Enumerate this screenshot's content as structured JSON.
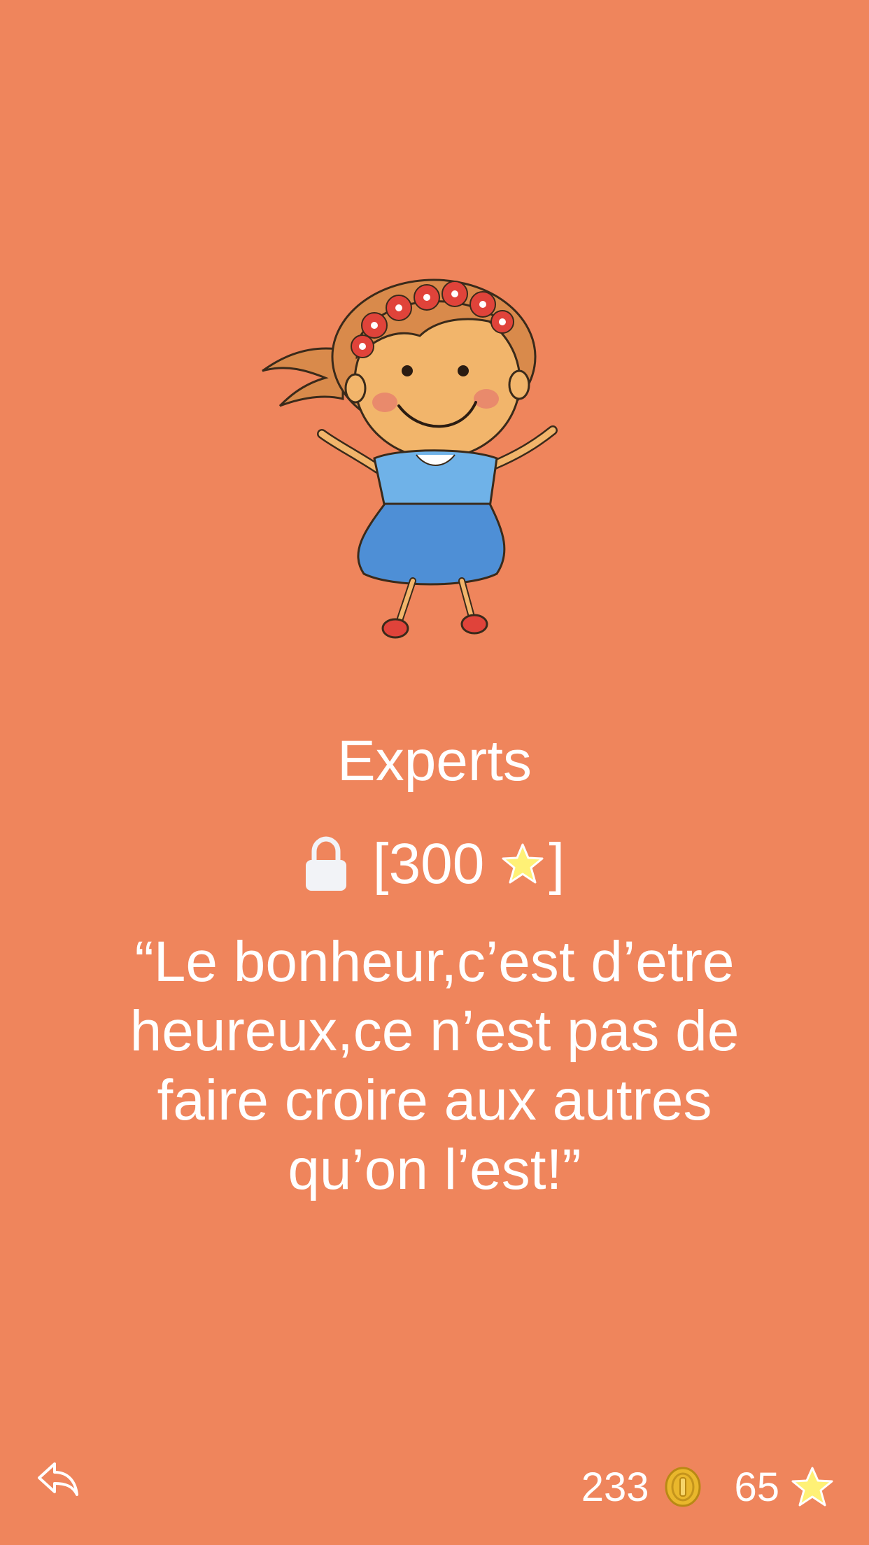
{
  "level": {
    "title": "Experts",
    "lock_cost_open": "[300",
    "lock_cost_close": "]",
    "quote": "“Le bonheur,c’est d’etre heureux,ce n’est pas de faire croire aux autres qu’on l’est!”"
  },
  "footer": {
    "coins": "233",
    "stars": "65"
  },
  "icons": {
    "lock": "lock-icon",
    "star": "star-icon",
    "coin": "coin-icon",
    "back": "back-arrow-icon"
  },
  "colors": {
    "background": "#EF855C",
    "text": "#FFFFFF",
    "star": "#FFF176",
    "coin": "#E9B72C"
  }
}
